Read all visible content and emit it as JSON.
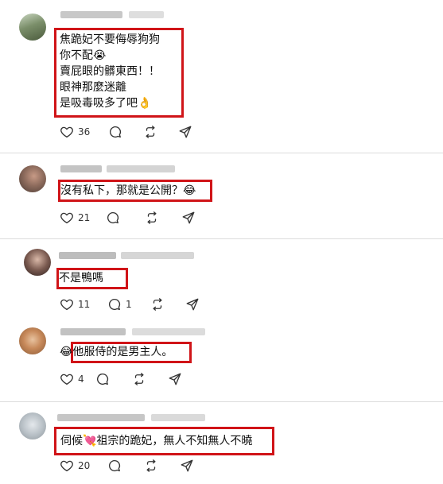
{
  "comments": [
    {
      "lines": [
        "焦跪妃不要侮辱狗狗",
        "你不配😭",
        "賣屁眼的髒東西！！",
        "眼神那麼迷離",
        "是吸毒吸多了吧👌"
      ],
      "likes": "36",
      "replies": ""
    },
    {
      "lines": [
        "沒有私下，那就是公開？😂"
      ],
      "likes": "21",
      "replies": ""
    },
    {
      "lines": [
        "不是鴨嗎"
      ],
      "likes": "11",
      "replies": "1"
    },
    {
      "lines": [
        "😂他服侍的是男主人。"
      ],
      "likes": "4",
      "replies": ""
    },
    {
      "lines": [
        "伺候💘祖宗的跪妃，無人不知無人不曉"
      ],
      "likes": "20",
      "replies": ""
    }
  ],
  "icons": {
    "like": "heart-icon",
    "reply": "comment-bubble-icon",
    "repost": "repost-icon",
    "share": "send-icon"
  },
  "colors": {
    "highlight_border": "#d01418",
    "separator": "#dcdcdc"
  }
}
